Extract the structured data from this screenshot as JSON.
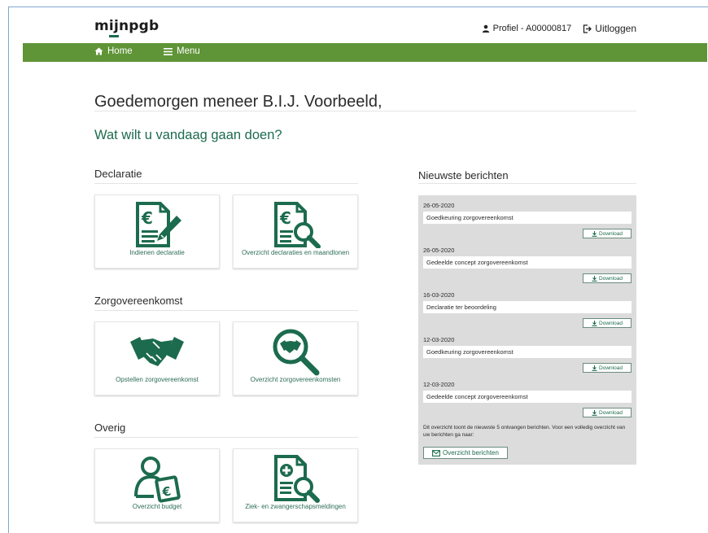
{
  "header": {
    "logo_prefix": "m",
    "logo_ij": "ij",
    "logo_suffix": "npgb",
    "profile_label": "Profiel - A00000817",
    "logout_label": "Uitloggen"
  },
  "nav": {
    "home_label": "Home",
    "menu_label": "Menu",
    "bar_color": "#5f9437"
  },
  "greeting": "Goedemorgen meneer B.I.J. Voorbeeld,",
  "question": "Wat wilt u vandaag gaan doen?",
  "sections": {
    "declaratie": {
      "title": "Declaratie",
      "tiles": [
        {
          "label": "Indienen declaratie",
          "icon": "euro-document-pen-icon"
        },
        {
          "label": "Overzicht declaraties en maandlonen",
          "icon": "euro-document-magnifier-icon"
        }
      ]
    },
    "zorg": {
      "title": "Zorgovereenkomst",
      "tiles": [
        {
          "label": "Opstellen zorgovereenkomst",
          "icon": "handshake-icon"
        },
        {
          "label": "Overzicht zorgovereenkomsten",
          "icon": "handshake-magnifier-icon"
        }
      ]
    },
    "overig": {
      "title": "Overig",
      "tiles": [
        {
          "label": "Overzicht budget",
          "icon": "person-euro-icon"
        },
        {
          "label": "Ziek- en zwangerschapsmeldingen",
          "icon": "medical-document-magnifier-icon"
        }
      ]
    }
  },
  "news": {
    "title": "Nieuwste berichten",
    "download_label": "Download",
    "messages": [
      {
        "date": "26-05-2020",
        "subject": "Goedkeuring zorgovereenkomst"
      },
      {
        "date": "26-05-2020",
        "subject": "Gedeelde concept zorgovereenkomst"
      },
      {
        "date": "16-03-2020",
        "subject": "Declaratie ter beoordeling"
      },
      {
        "date": "12-03-2020",
        "subject": "Goedkeuring zorgovereenkomst"
      },
      {
        "date": "12-03-2020",
        "subject": "Gedeelde concept zorgovereenkomst"
      }
    ],
    "note": "Dit overzicht toont de nieuwste 5 ontvangen berichten. Voor een volledig overzicht van uw berichten ga naar:",
    "overview_label": "Overzicht berichten"
  },
  "colors": {
    "brand_green": "#1c6b4e",
    "nav_green": "#5f9437",
    "panel_grey": "#dcdcdc"
  }
}
